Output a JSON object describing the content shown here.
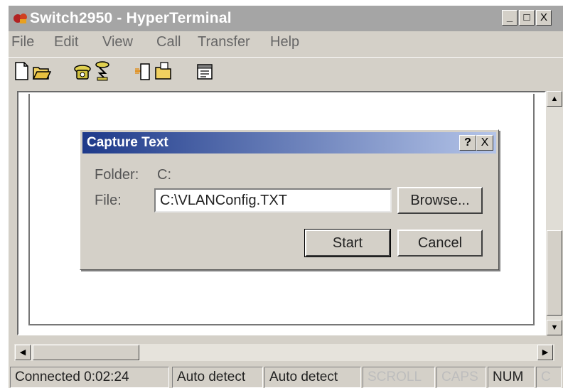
{
  "window": {
    "title": "Switch2950 - HyperTerminal",
    "minimize_glyph": "_",
    "maximize_glyph": "□",
    "close_glyph": "X"
  },
  "menu": {
    "items": [
      "File",
      "Edit",
      "View",
      "Call",
      "Transfer",
      "Help"
    ]
  },
  "toolbar": {
    "icons": [
      "new-connection-icon",
      "open-icon",
      "call-icon",
      "disconnect-icon",
      "send-icon",
      "receive-icon",
      "properties-icon"
    ]
  },
  "dialog": {
    "title": "Capture Text",
    "help_glyph": "?",
    "close_glyph": "X",
    "folder_label": "Folder:",
    "folder_value": "C:",
    "file_label": "File:",
    "file_value": "C:\\VLANConfig.TXT",
    "browse_label": "Browse...",
    "start_label": "Start",
    "cancel_label": "Cancel"
  },
  "statusbar": {
    "connected": "Connected 0:02:24",
    "detect1": "Auto detect",
    "detect2": "Auto detect",
    "scroll": "SCROLL",
    "caps": "CAPS",
    "num": "NUM",
    "capture": "C"
  },
  "colors": {
    "dialog_title_bg": "#1e3a8a",
    "title_bar_inactive": "#a5a5a5",
    "chrome": "#d4d0c8"
  }
}
